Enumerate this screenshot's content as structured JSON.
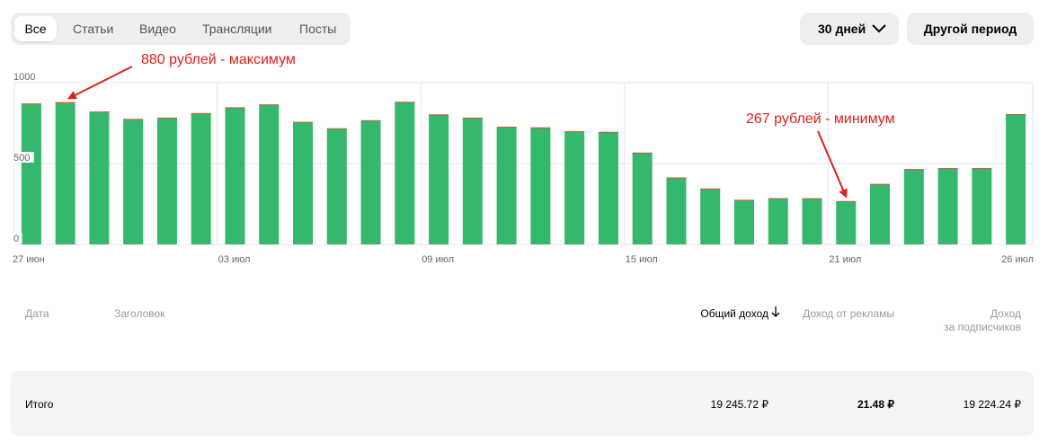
{
  "tabs": [
    {
      "label": "Все",
      "active": true
    },
    {
      "label": "Статьи",
      "active": false
    },
    {
      "label": "Видео",
      "active": false
    },
    {
      "label": "Трансляции",
      "active": false
    },
    {
      "label": "Посты",
      "active": false
    }
  ],
  "period": {
    "selected": "30 дней",
    "other_label": "Другой период"
  },
  "colors": {
    "bar": "#33b86e",
    "bar_cap_orange": "#e2941f",
    "bar_cap_red": "#d9543b",
    "annotation": "#e0201b",
    "grid": "#e6e6e6"
  },
  "chart_data": {
    "type": "bar",
    "ylim": [
      0,
      1000
    ],
    "y_ticks": [
      "1000",
      "500",
      "0"
    ],
    "y_tick_values": [
      1000,
      500,
      0
    ],
    "x_tick_labels": [
      {
        "index": 0,
        "label": "27 июн"
      },
      {
        "index": 6,
        "label": "03 июл"
      },
      {
        "index": 12,
        "label": "09 июл"
      },
      {
        "index": 18,
        "label": "15 июл"
      },
      {
        "index": 24,
        "label": "21 июл"
      },
      {
        "index": 29,
        "label": "26 июл"
      }
    ],
    "values": [
      866,
      870,
      816,
      770,
      778,
      806,
      842,
      860,
      752,
      712,
      762,
      876,
      798,
      778,
      722,
      718,
      694,
      690,
      562,
      408,
      340,
      270,
      280,
      280,
      262,
      368,
      460,
      466,
      466,
      800
    ],
    "caps": [
      6,
      10,
      6,
      6,
      6,
      6,
      6,
      6,
      6,
      6,
      6,
      6,
      6,
      6,
      6,
      6,
      6,
      6,
      6,
      6,
      6,
      6,
      6,
      6,
      6,
      6,
      6,
      6,
      6,
      6
    ],
    "grid": true,
    "annotations": [
      {
        "text": "880 рублей  - максимум",
        "bar_index": 1
      },
      {
        "text": "267 рублей - минимум",
        "bar_index": 24
      }
    ]
  },
  "table": {
    "headers": {
      "date": "Дата",
      "title": "Заголовок",
      "total_income": "Общий доход",
      "ad_income": "Доход от рекламы",
      "sub_income_line1": "Доход",
      "sub_income_line2": "за подписчиков"
    },
    "total_row": {
      "label": "Итого",
      "total_income": "19 245.72 ₽",
      "ad_income": "21.48 ₽",
      "sub_income": "19 224.24 ₽"
    }
  }
}
